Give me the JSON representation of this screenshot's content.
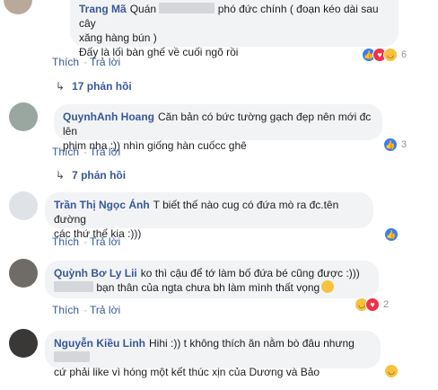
{
  "comments": [
    {
      "name": "Trang Mã",
      "line1_before": "Quán",
      "line1_after": "phó đức chính ( đoạn kéo dài sau cây",
      "line2": "xăng hàng bún )",
      "line3": "Đấy là lối bàn ghế về cuối ngõ rồi",
      "reaction_count": "6",
      "reaction_types": [
        "like",
        "love",
        "haha"
      ]
    },
    {
      "name": "QuynhAnh Hoang",
      "line1": "Căn bản có bức tường gạch đẹp nên mới đc lên",
      "line2": "phim nha :)) nhìn giống hàn cuốcc ghê",
      "reaction_count": "3",
      "reaction_types": [
        "like"
      ]
    },
    {
      "name": "Trần Thị Ngọc Ánh",
      "line1": "T biết thế nào cug có đứa mò ra đc.tên đường",
      "line2": "các thứ thế kia :)))",
      "reaction_count": "",
      "reaction_types": [
        "like"
      ]
    },
    {
      "name": "Quỳnh Bơ Ly Lii",
      "line1": "ko thì cậu để tớ làm bố đứa bé cũng được :)))",
      "line2_after": "bạn thân của ngta chưa bh làm mình thất vọng",
      "reaction_count": "2",
      "reaction_types": [
        "haha",
        "love"
      ]
    },
    {
      "name": "Nguyễn Kiều Linh",
      "line1": "Hihi :)) t không thích ăn nằm bò đâu nhưng",
      "line2": "cứ phải like vì hóng một kết thúc xịn của Dương và Bảo",
      "reaction_count": "",
      "reaction_types": [
        "haha"
      ]
    }
  ],
  "actions": {
    "like": "Thích",
    "reply": "Trả lời",
    "dot": "·"
  },
  "reply_threads": [
    "17 phản hồi",
    "7 phản hồi"
  ],
  "colors": {
    "link": "#385898",
    "bubble": "#f2f3f5"
  }
}
